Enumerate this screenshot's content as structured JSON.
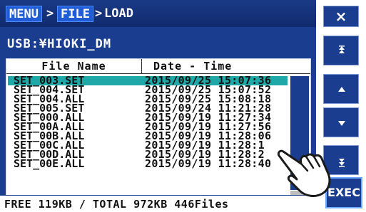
{
  "breadcrumb": {
    "menu": "MENU",
    "sep1": ">",
    "file": "FILE",
    "sep2": ">",
    "load": "LOAD"
  },
  "path": "USB:¥HIOKI_DM",
  "table": {
    "headers": {
      "file_name": "File Name",
      "date_time": "Date - Time"
    },
    "rows": [
      {
        "file": "SET_003.SET",
        "datetime": "2015/09/25 15:07:36",
        "selected": true
      },
      {
        "file": "SET_004.SET",
        "datetime": "2015/09/25 15:07:52"
      },
      {
        "file": "SET_004.ALL",
        "datetime": "2015/09/25 15:08:18"
      },
      {
        "file": "SET_005.SET",
        "datetime": "2015/09/24 11:21:28"
      },
      {
        "file": "SET_000.ALL",
        "datetime": "2015/09/19 11:27:34"
      },
      {
        "file": "SET_00A.ALL",
        "datetime": "2015/09/19 11:27:56"
      },
      {
        "file": "SET_00B.ALL",
        "datetime": "2015/09/19 11:28:06"
      },
      {
        "file": "SET_00C.ALL",
        "datetime": "2015/09/19 11:28:1"
      },
      {
        "file": "SET_00D.ALL",
        "datetime": "2015/09/19 11:28:2"
      },
      {
        "file": "SET_00E.ALL",
        "datetime": "2015/09/19 11:28:40"
      }
    ]
  },
  "footer": "FREE 119KB / TOTAL 972KB 446Files",
  "buttons": {
    "close": "×",
    "exec": "EXEC"
  },
  "icons": {
    "page_up": "double-up-arrow-icon",
    "line_up": "up-triangle-icon",
    "line_down": "down-triangle-icon",
    "page_down": "double-down-arrow-icon",
    "hand": "pointing-hand-icon"
  },
  "colors": {
    "panel": "#1b3d8f",
    "selection": "#20a8a8",
    "title_bar": "#112a6e",
    "crumb_highlight": "#1f5cd6"
  }
}
